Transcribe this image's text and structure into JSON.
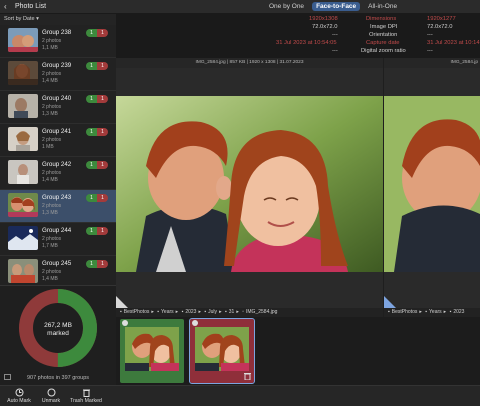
{
  "app": {
    "title": "Photo List",
    "back_label": "‹"
  },
  "modes": [
    {
      "label": "One by One",
      "active": false
    },
    {
      "label": "Face-to-Face",
      "active": true
    },
    {
      "label": "All-in-One",
      "active": false
    }
  ],
  "sidebar": {
    "sort_label": "Sort by Date ▾",
    "groups": [
      {
        "title": "Group 238",
        "count": "2 photos",
        "size": "1,1 MB",
        "keep": "1",
        "delete": "1",
        "selected": false
      },
      {
        "title": "Group 239",
        "count": "2 photos",
        "size": "1,4 MB",
        "keep": "1",
        "delete": "1",
        "selected": false
      },
      {
        "title": "Group 240",
        "count": "2 photos",
        "size": "1,3 MB",
        "keep": "1",
        "delete": "1",
        "selected": false
      },
      {
        "title": "Group 241",
        "count": "2 photos",
        "size": "1 MB",
        "keep": "1",
        "delete": "1",
        "selected": false
      },
      {
        "title": "Group 242",
        "count": "2 photos",
        "size": "1,4 MB",
        "keep": "1",
        "delete": "1",
        "selected": false
      },
      {
        "title": "Group 243",
        "count": "2 photos",
        "size": "1,3 MB",
        "keep": "1",
        "delete": "1",
        "selected": true
      },
      {
        "title": "Group 244",
        "count": "2 photos",
        "size": "1,7 MB",
        "keep": "1",
        "delete": "1",
        "selected": false
      },
      {
        "title": "Group 245",
        "count": "2 photos",
        "size": "1,4 MB",
        "keep": "1",
        "delete": "1",
        "selected": false
      }
    ],
    "stats": {
      "size": "267,2 MB",
      "marked_label": "marked",
      "marked_fraction": 0.5,
      "total": "907 photos in 397 groups",
      "colors": {
        "keep": "#3d8a3d",
        "marked": "#8f3a3a"
      }
    }
  },
  "info": {
    "left_size": "1920x1308",
    "right_size": "1920x1277",
    "label_dimensions": "Dimensions",
    "left_dpi": "72.0x72.0",
    "label_dpi": "Image DPI",
    "right_dpi": "72.0x72.0",
    "label_orientation": "Orientation",
    "left_orientation": "---",
    "right_orientation": "---",
    "left_date": "31 Jul 2023 at 10:54:05",
    "label_capture": "Capture date",
    "right_date": "31 Jul 2023 at 10:14",
    "left_zoom": "---",
    "label_zoom": "Digital zoom ratio",
    "right_zoom": "---"
  },
  "viewer": {
    "left_header": "IMG_2584.jpg | 857 KB | 1920 x 1308 | 31.07.2023",
    "right_header": "IMG_2584.jp"
  },
  "path": {
    "left": [
      "BestPhotos",
      "Years",
      "2023",
      "July",
      "31",
      "IMG_2584.jpg"
    ],
    "right": [
      "BestPhotos",
      "Years",
      "2023"
    ]
  },
  "toolbar": {
    "auto_mark": "Auto Mark",
    "unmark": "Unmark",
    "trash_marked": "Trash Marked"
  }
}
